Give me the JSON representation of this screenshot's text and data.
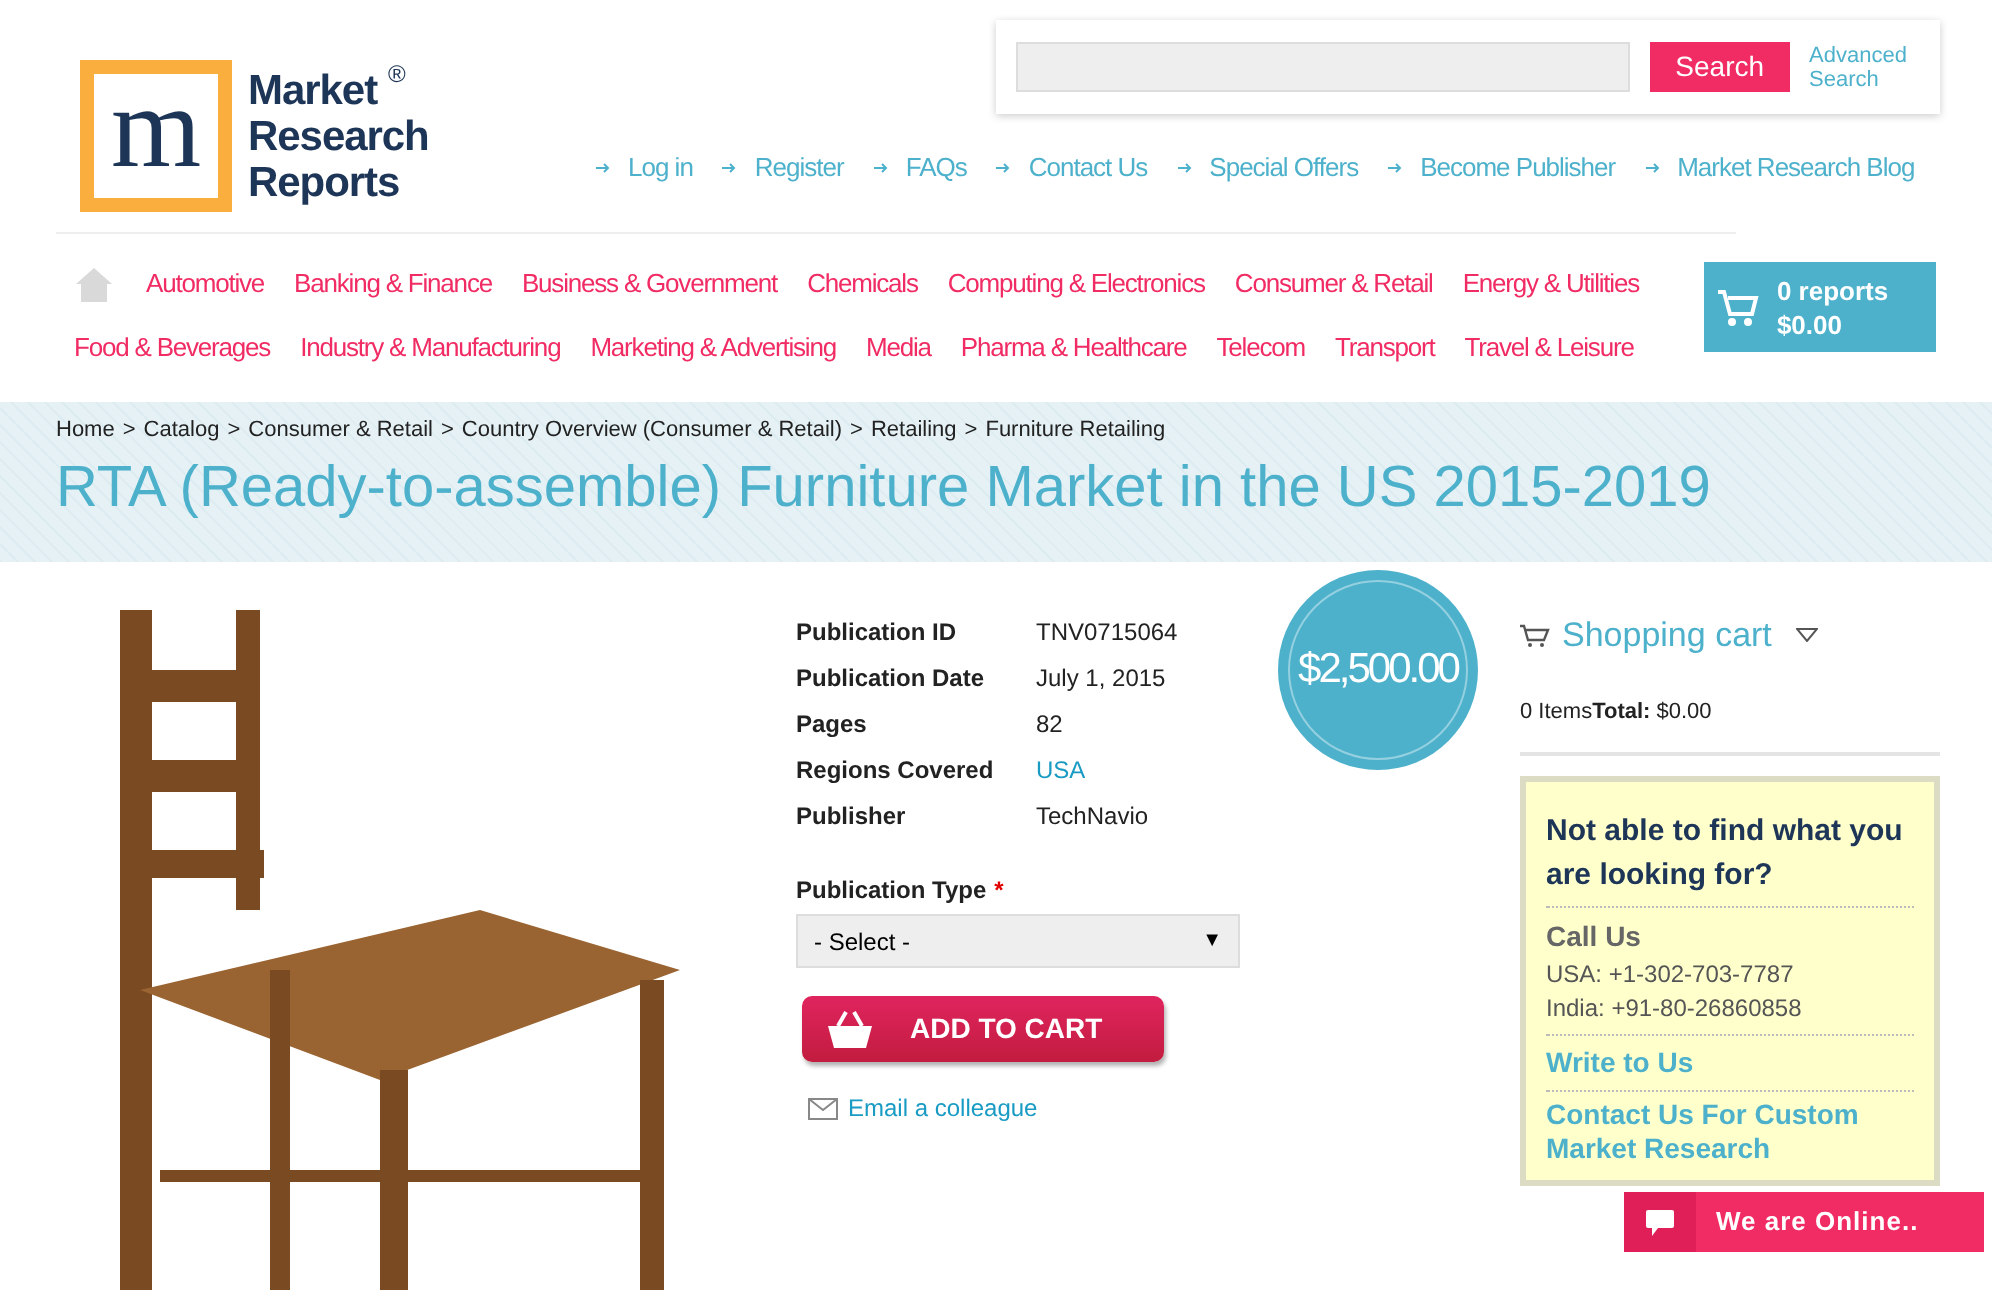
{
  "logo": {
    "mark": "m",
    "lines": [
      "Market",
      "Research",
      "Reports"
    ],
    "registered": "®"
  },
  "search": {
    "button": "Search",
    "advanced": "Advanced Search"
  },
  "top_links": [
    "Log in",
    "Register",
    "FAQs",
    "Contact Us",
    "Special Offers",
    "Become Publisher",
    "Market Research Blog"
  ],
  "categories": [
    [
      "Automotive",
      "Banking & Finance",
      "Business & Government",
      "Chemicals",
      "Computing & Electronics",
      "Consumer & Retail",
      "Energy & Utilities"
    ],
    [
      "Food & Beverages",
      "Industry & Manufacturing",
      "Marketing & Advertising",
      "Media",
      "Pharma & Healthcare",
      "Telecom",
      "Transport",
      "Travel & Leisure"
    ]
  ],
  "cart_button": {
    "count": "0 reports",
    "total": "$0.00"
  },
  "breadcrumb": [
    {
      "label": "Home",
      "separator": ">"
    },
    {
      "label": "Catalog",
      "separator": ">"
    },
    {
      "label": "Consumer & Retail",
      "separator": ">"
    },
    {
      "label": "Country Overview (Consumer & Retail)",
      "separator": ">"
    },
    {
      "label": "Retailing",
      "separator": ">"
    },
    {
      "label": "Furniture Retailing"
    }
  ],
  "title": "RTA (Ready-to-assemble) Furniture Market in the US 2015-2019",
  "details": [
    {
      "label": "Publication ID",
      "value": "TNV0715064",
      "kind": "text"
    },
    {
      "label": "Publication Date",
      "value": "July 1, 2015",
      "kind": "text"
    },
    {
      "label": "Pages",
      "value": "82",
      "kind": "text"
    },
    {
      "label": "Regions Covered",
      "value": "USA",
      "kind": "link"
    },
    {
      "label": "Publisher",
      "value": "TechNavio",
      "kind": "text"
    }
  ],
  "price": "$2,500.00",
  "publication_type": {
    "label": "Publication Type",
    "required_mark": "*",
    "value": "- Select -",
    "arrow": "▼"
  },
  "add_to_cart": "ADD TO CART",
  "email_link": "Email a colleague",
  "shopping_cart": {
    "title": "Shopping cart",
    "items": "0 Items",
    "total_label": "Total:",
    "total": "$0.00"
  },
  "help_box": {
    "heading": "Not able to find what you are looking for?",
    "call_title": "Call Us",
    "phones": [
      "USA: +1-302-703-7787",
      "India: +91-80-26860858"
    ],
    "write": "Write to Us",
    "custom": "Contact Us For Custom Market Research"
  },
  "chat": {
    "label": "We are Online.."
  }
}
